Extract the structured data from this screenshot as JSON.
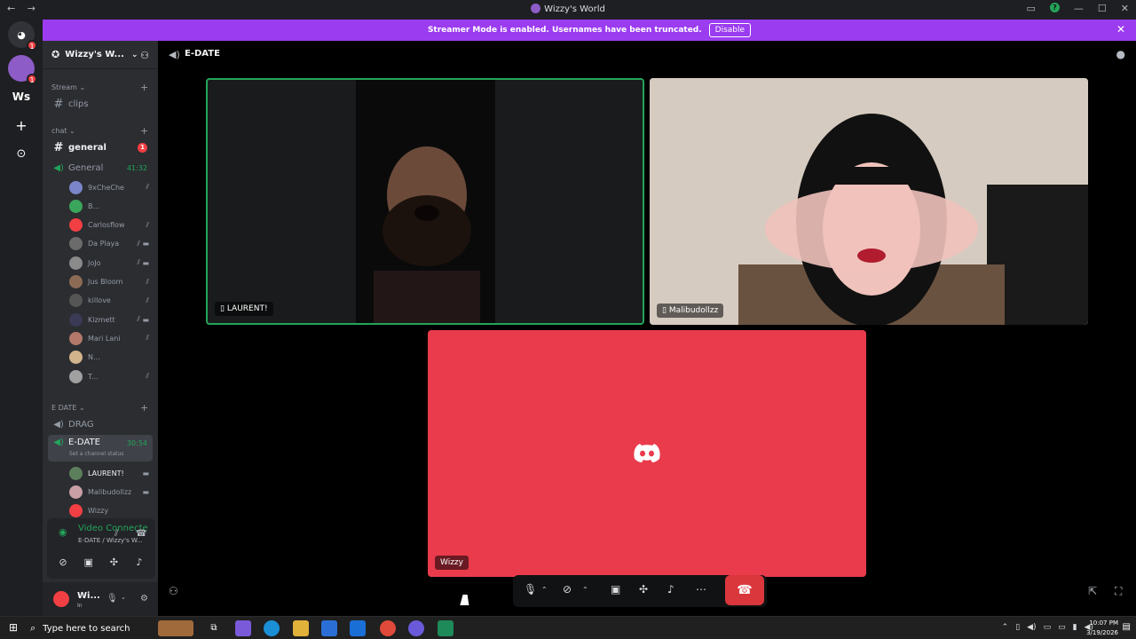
{
  "window": {
    "title": "Wizzy's World",
    "back": "←",
    "forward": "→",
    "minimize": "—",
    "maximize": "☐",
    "close": "✕"
  },
  "banner": {
    "text": "Streamer Mode is enabled. Usernames have been truncated.",
    "button": "Disable",
    "close": "✕"
  },
  "rail": {
    "home_badge": "1",
    "server_badge": "1",
    "ws_label": "Ws",
    "add": "+",
    "discover": "⊙"
  },
  "server": {
    "name": "Wizzy's W...",
    "chevron": "⌄"
  },
  "categories": {
    "stream": "Stream",
    "chat": "chat",
    "edate": "E DATE"
  },
  "channels": {
    "clips": "clips",
    "general_text": "general",
    "general_text_badge": "1",
    "general_voice": "General",
    "general_voice_timer": "41:32",
    "drag": "DRAG",
    "edate": "E-DATE",
    "edate_timer": "30:54",
    "edate_status": "Set a channel status"
  },
  "general_users": [
    {
      "name": "9xCheChe",
      "color": "#7a86c9"
    },
    {
      "name": "B...",
      "color": "#3ba55c"
    },
    {
      "name": "Carlosflow",
      "color": "#f23f43"
    },
    {
      "name": "Da Playa",
      "color": "#6b6b6b"
    },
    {
      "name": "JoJo",
      "color": "#8a8a8a"
    },
    {
      "name": "Jus Bloom",
      "color": "#8c6b55"
    },
    {
      "name": "killove",
      "color": "#555"
    },
    {
      "name": "Kizmett",
      "color": "#3a3a55"
    },
    {
      "name": "Mari Lani",
      "color": "#b3786a"
    },
    {
      "name": "N...",
      "color": "#d2b48c"
    },
    {
      "name": "T...",
      "color": "#a0a0a0"
    }
  ],
  "edate_users": [
    {
      "name": "LAURENT!",
      "color": "#5a7f5a"
    },
    {
      "name": "Malibudollzz",
      "color": "#c89fa5"
    },
    {
      "name": "Wizzy",
      "color": "#f23f43"
    }
  ],
  "voice_panel": {
    "title": "Video Connecte",
    "subtitle": "E-DATE / Wizzy's W..."
  },
  "user_panel": {
    "name": "Wi...",
    "status": "In"
  },
  "main": {
    "channel_name": "E-DATE"
  },
  "tiles": {
    "laurent": "LAURENT!",
    "malibu": "Malibudollzz",
    "wizzy": "Wizzy"
  },
  "taskbar": {
    "search_placeholder": "Type here to search",
    "time": "10:07 PM",
    "date": "3/19/2026"
  },
  "colors": {
    "accent_banner": "#9b3cf0",
    "speaking_green": "#23a55a",
    "wizzy_tile": "#ea3b4c",
    "danger": "#da373c"
  }
}
